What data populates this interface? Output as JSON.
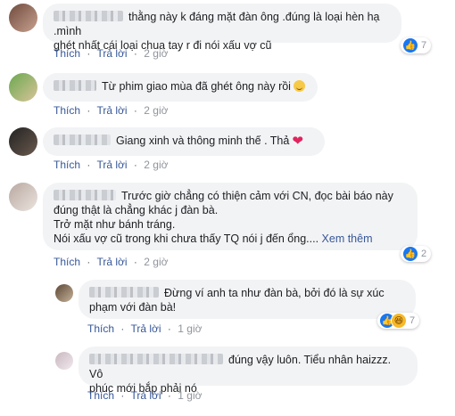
{
  "actions": {
    "like": "Thích",
    "reply": "Trả lời",
    "dot": "·"
  },
  "comments": [
    {
      "text_line1": "thằng này k đáng mặt đàn ông .đúng là loại hèn hạ .mình",
      "text_line2": "ghét nhất cái loại chua tay r đi nói xấu vợ cũ",
      "time": "2 giờ",
      "reaction_count": "7"
    },
    {
      "text": "Từ phim giao mùa đã ghét ông này rồi",
      "time": "2 giờ"
    },
    {
      "text": "Giang xinh và thông minh thế . Thả",
      "time": "2 giờ"
    },
    {
      "text_line1": "Trước giờ chẳng có thiện cảm với CN, đọc bài báo này",
      "text_line2": "đúng thật là chẳng khác j đàn bà.",
      "text_line3": "Trở mặt như bánh tráng.",
      "text_line4": "Nói xấu vợ cũ trong khi chưa thấy TQ nói j đến ổng....",
      "see_more": "Xem thêm",
      "time": "2 giờ",
      "reaction_count": "2"
    }
  ],
  "replies": [
    {
      "text_line1": "Đừng ví anh ta như đàn bà, bởi đó là sự xúc",
      "text_line2": "phạm với đàn bà!",
      "time": "1 giờ",
      "reaction_count": "7"
    },
    {
      "text_line1": "đúng vậy luôn. Tiểu nhân haizzz. Vô",
      "text_line2": "phúc mới bắp phải nó",
      "time": "1 giờ"
    }
  ]
}
